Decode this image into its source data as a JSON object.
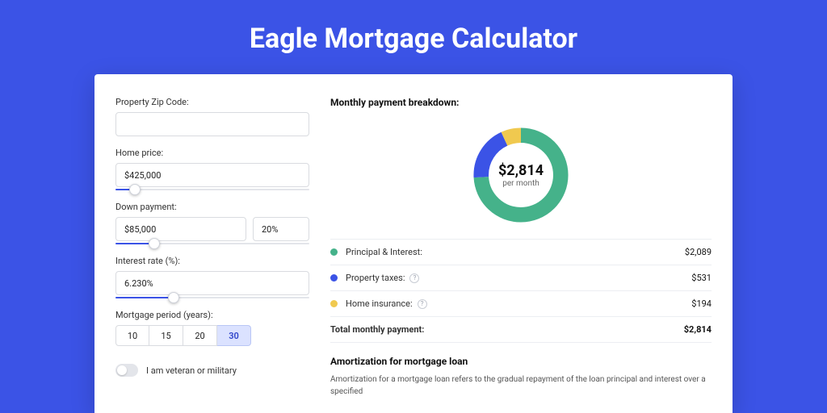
{
  "page": {
    "title": "Eagle Mortgage Calculator"
  },
  "form": {
    "zip_label": "Property Zip Code:",
    "zip_value": "",
    "zip_placeholder": "",
    "home_price_label": "Home price:",
    "home_price_value": "$425,000",
    "home_price_slider_pct": 10,
    "down_payment_label": "Down payment:",
    "down_payment_value": "$85,000",
    "down_payment_pct_value": "20%",
    "down_payment_slider_pct": 20,
    "interest_label": "Interest rate (%):",
    "interest_value": "6.230%",
    "interest_slider_pct": 30,
    "period_label": "Mortgage period (years):",
    "periods": [
      "10",
      "15",
      "20",
      "30"
    ],
    "period_selected": "30",
    "veteran_label": "I am veteran or military",
    "veteran_on": false
  },
  "breakdown": {
    "title": "Monthly payment breakdown:",
    "center_value": "$2,814",
    "center_sub": "per month",
    "items": [
      {
        "key": "pi",
        "label": "Principal & Interest:",
        "value": "$2,089",
        "color": "#45b28a",
        "info": false,
        "pct": 74
      },
      {
        "key": "tax",
        "label": "Property taxes:",
        "value": "$531",
        "color": "#3b53e6",
        "info": true,
        "pct": 19
      },
      {
        "key": "ins",
        "label": "Home insurance:",
        "value": "$194",
        "color": "#f0c94f",
        "info": true,
        "pct": 7
      }
    ],
    "total_label": "Total monthly payment:",
    "total_value": "$2,814"
  },
  "amort": {
    "title": "Amortization for mortgage loan",
    "text": "Amortization for a mortgage loan refers to the gradual repayment of the loan principal and interest over a specified"
  },
  "chart_data": {
    "type": "pie",
    "title": "Monthly payment breakdown",
    "series": [
      {
        "name": "Principal & Interest",
        "value": 2089,
        "color": "#45b28a"
      },
      {
        "name": "Property taxes",
        "value": 531,
        "color": "#3b53e6"
      },
      {
        "name": "Home insurance",
        "value": 194,
        "color": "#f0c94f"
      }
    ],
    "total": 2814,
    "center_label": "$2,814 per month"
  }
}
